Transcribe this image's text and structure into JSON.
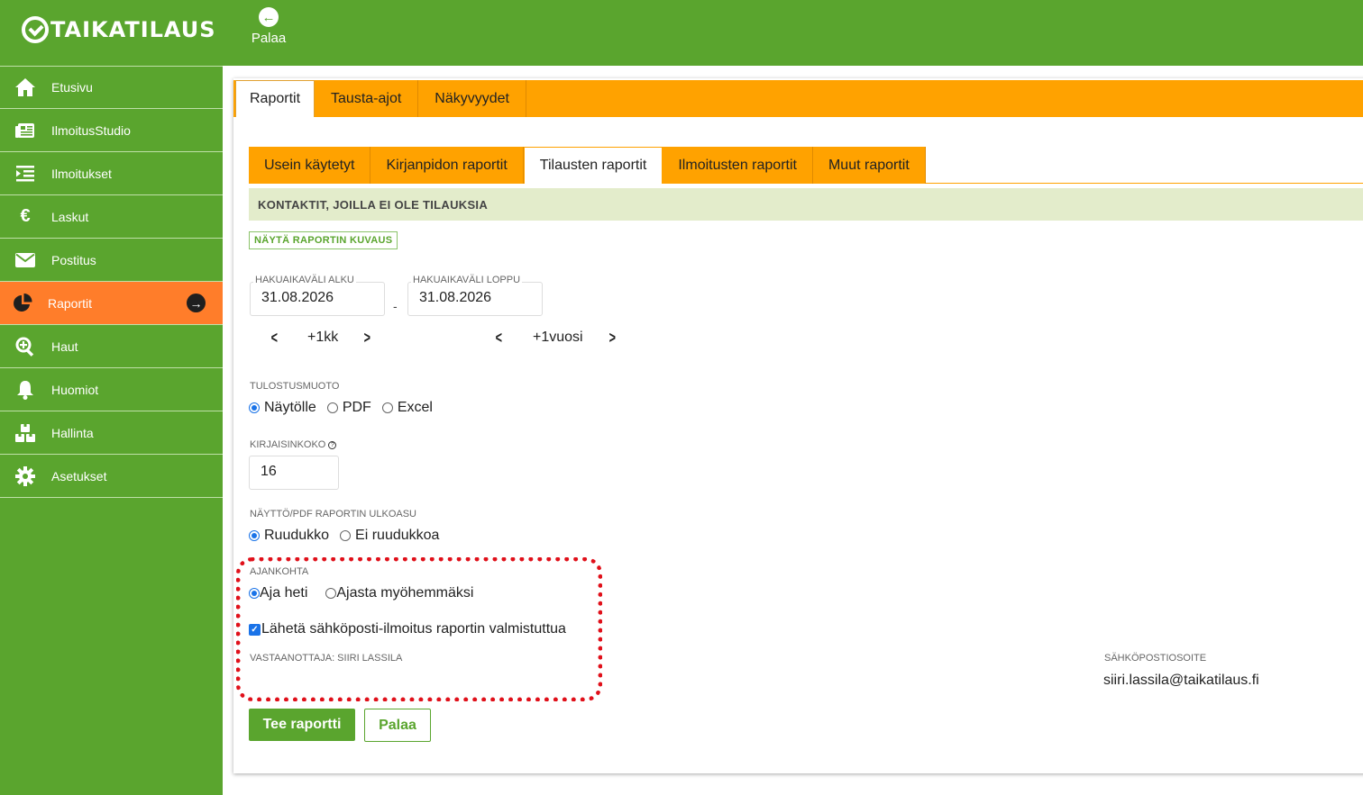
{
  "app": {
    "brand": "TAIKATILAUS",
    "back_label": "Palaa"
  },
  "sidebar": {
    "items": [
      {
        "label": "Etusivu",
        "icon": "home-icon"
      },
      {
        "label": "IlmoitusStudio",
        "icon": "newspaper-icon"
      },
      {
        "label": "Ilmoitukset",
        "icon": "list-indent-icon"
      },
      {
        "label": "Laskut",
        "icon": "euro-icon"
      },
      {
        "label": "Postitus",
        "icon": "envelope-icon"
      },
      {
        "label": "Raportit",
        "icon": "pie-chart-icon",
        "active": true
      },
      {
        "label": "Haut",
        "icon": "search-plus-icon"
      },
      {
        "label": "Huomiot",
        "icon": "bell-icon"
      },
      {
        "label": "Hallinta",
        "icon": "boxes-icon"
      },
      {
        "label": "Asetukset",
        "icon": "gear-icon"
      }
    ]
  },
  "tabs_top": [
    "Raportit",
    "Tausta-ajot",
    "Näkyvyydet"
  ],
  "tabs_reports": [
    "Usein käytetyt",
    "Kirjanpidon raportit",
    "Tilausten raportit",
    "Ilmoitusten raportit",
    "Muut raportit"
  ],
  "report": {
    "title": "KONTAKTIT, JOILLA EI OLE TILAUKSIA",
    "desc_button": "NÄYTÄ RAPORTIN KUVAUS"
  },
  "range": {
    "start_label": "HAKUAIKAVÄLI ALKU",
    "start_value": "31.08.2026",
    "end_label": "HAKUAIKAVÄLI LOPPU",
    "end_value": "31.08.2026",
    "dash": "-",
    "step_month": "+1kk",
    "step_year": "+1vuosi"
  },
  "output": {
    "label": "TULOSTUSMUOTO",
    "options": [
      "Näytölle",
      "PDF",
      "Excel"
    ],
    "selected": "Näytölle"
  },
  "font_size": {
    "label": "KIRJAISINKOKO",
    "value": "16"
  },
  "layout": {
    "label": "NÄYTTÖ/PDF RAPORTIN ULKOASU",
    "options": [
      "Ruudukko",
      "Ei ruudukkoa"
    ],
    "selected": "Ruudukko"
  },
  "timing": {
    "label": "AJANKOHTA",
    "options": [
      "Aja heti",
      "Ajasta myöhemmäksi"
    ],
    "selected": "Aja heti",
    "notify_label": "Lähetä sähköposti-ilmoitus raportin valmistuttua",
    "notify_checked": true,
    "recipient_label": "VASTAANOTTAJA: SIIRI LASSILA",
    "email_label": "SÄHKÖPOSTIOSOITE",
    "email_value": "siiri.lassila@taikatilaus.fi"
  },
  "actions": {
    "submit": "Tee raportti",
    "back": "Palaa"
  },
  "colors": {
    "green": "#5aa52e",
    "orange_tab": "#ffa200",
    "active_nav": "#ff7d2a",
    "highlight": "#e0101a"
  }
}
